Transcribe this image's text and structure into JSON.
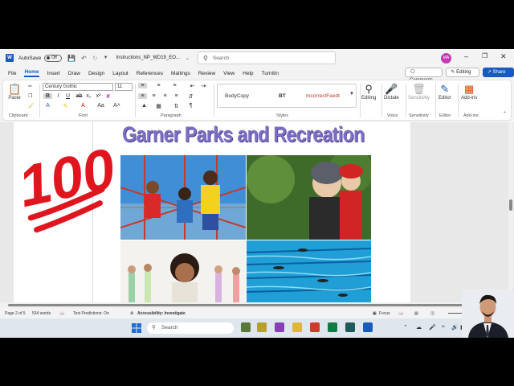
{
  "titlebar": {
    "autosave_label": "AutoSave",
    "autosave_state": "Off",
    "document_title": "Instructions_NP_WD19_EO...",
    "search_placeholder": "Search",
    "user_initials": "MA"
  },
  "menu": {
    "tabs": [
      "File",
      "Home",
      "Insert",
      "Draw",
      "Design",
      "Layout",
      "References",
      "Mailings",
      "Review",
      "View",
      "Help",
      "Turnitin"
    ],
    "active_tab": "Home",
    "comments_label": "Comments",
    "editing_label": "Editing",
    "share_label": "Share"
  },
  "ribbon": {
    "paste_label": "Paste",
    "font_name": "Century Gothic",
    "font_size": "11",
    "styles": [
      "BodyCopy",
      "BT",
      "IncorrectFeedt"
    ],
    "editing_label": "Editing",
    "dictate_label": "Dictate",
    "sensitivity_label": "Sensitivity",
    "editor_label": "Editor",
    "addins_label": "Add-ins",
    "group_labels": {
      "clipboard": "Clipboard",
      "font": "Font",
      "paragraph": "Paragraph",
      "styles": "Styles",
      "voice": "Voice",
      "sensitivity": "Sensitivity",
      "editor": "Editor",
      "addins": "Add-ins"
    }
  },
  "document": {
    "heading": "Garner Parks and Recreation",
    "sticker_text": "100"
  },
  "status": {
    "page": "Page 2 of 5",
    "words": "534 words",
    "text_predictions": "Text Predictions: On",
    "accessibility": "Accessibility: Investigate",
    "focus": "Focus"
  },
  "taskbar": {
    "search_placeholder": "Search"
  },
  "colors": {
    "word_blue": "#185abd",
    "heading_purple": "#7f6fc4",
    "sticker_red": "#e0161f"
  }
}
